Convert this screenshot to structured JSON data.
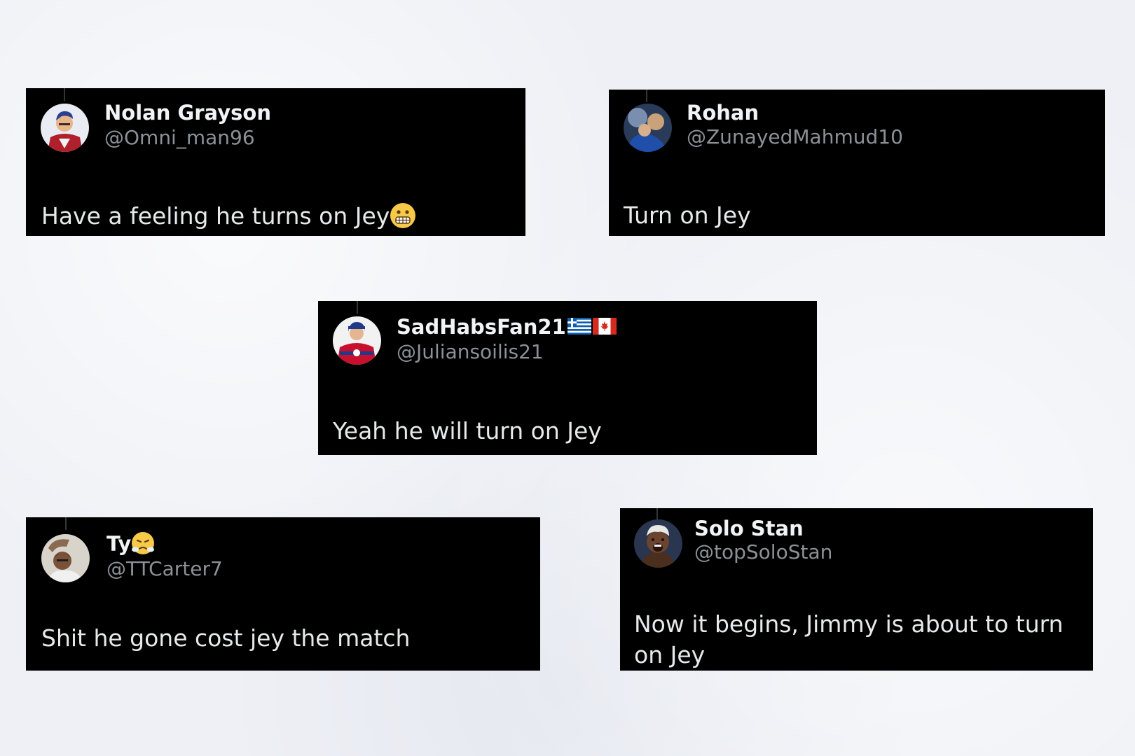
{
  "tweets": [
    {
      "name": "Nolan Grayson",
      "handle": "@Omni_man96",
      "text": "Have a feeling he turns on Jey",
      "avatar_icon": "cartoon-superhero-avatar",
      "emoji_icon": "grimacing-face-emoji"
    },
    {
      "name": "Rohan",
      "handle": "@ZunayedMahmud10",
      "text": "Turn on Jey",
      "avatar_icon": "photo-avatar"
    },
    {
      "name": "SadHabsFan21",
      "handle": "@Juliansoilis21",
      "text": "Yeah he will turn on Jey",
      "avatar_icon": "hockey-player-avatar",
      "flags": [
        "greece-flag-emoji",
        "canada-flag-emoji"
      ]
    },
    {
      "name": "Ty",
      "handle": "@TTCarter7",
      "text": "Shit he gone cost jey the match",
      "avatar_icon": "person-photo-avatar",
      "emoji_icon": "face-with-steam-emoji"
    },
    {
      "name": "Solo Stan",
      "handle": "@topSoloStan",
      "text": "Now it begins, Jimmy is about to turn on Jey",
      "avatar_icon": "wrestler-photo-avatar"
    }
  ],
  "colors": {
    "card_background": "#000000",
    "name_text": "#f1f3f4",
    "handle_text": "#8b9197",
    "page_background": "#eef0f5"
  }
}
